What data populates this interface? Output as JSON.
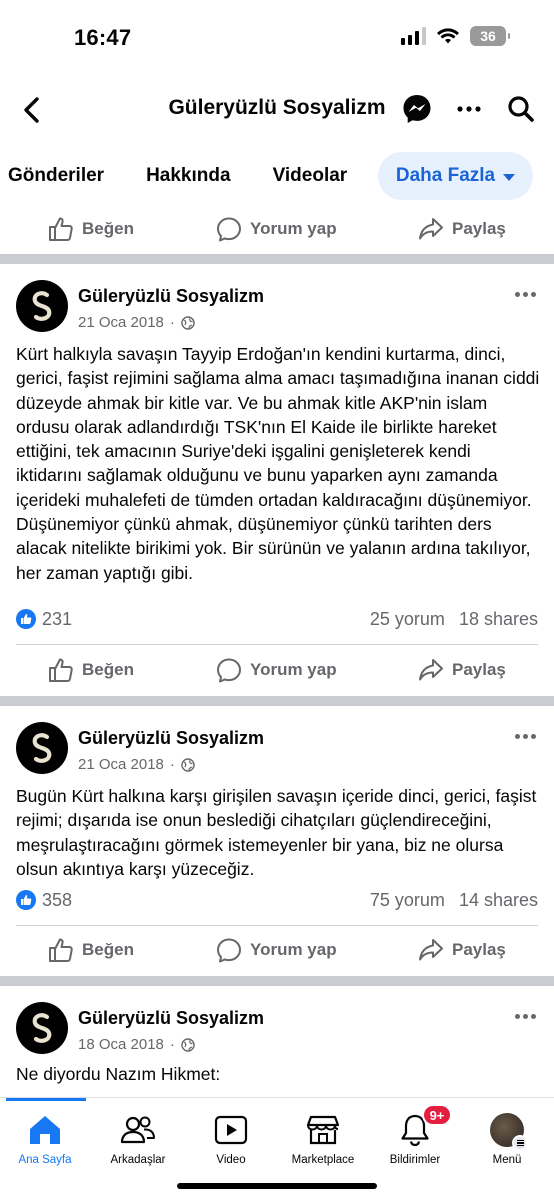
{
  "status_bar": {
    "time": "16:47",
    "battery": "36"
  },
  "header": {
    "title": "Güleryüzlü Sosyalizm"
  },
  "tabs": [
    {
      "label": "Gönderiler"
    },
    {
      "label": "Hakkında"
    },
    {
      "label": "Videolar"
    },
    {
      "label": "Daha Fazla",
      "active": true
    }
  ],
  "actions": {
    "like": "Beğen",
    "comment": "Yorum yap",
    "share": "Paylaş"
  },
  "posts": [
    {
      "author": "Güleryüzlü Sosyalizm",
      "date": "21 Oca 2018",
      "text": "Kürt halkıyla savaşın Tayyip Erdoğan'ın kendini kurtarma, dinci, gerici, faşist rejimini sağlama alma amacı taşımadığına inanan ciddi düzeyde ahmak bir kitle var. Ve bu ahmak kitle AKP'nin islam ordusu olarak adlandırdığı TSK'nın El Kaide ile birlikte hareket ettiğini, tek amacının Suriye'deki işgalini genişleterek kendi iktidarını sağlamak olduğunu ve bunu yaparken aynı zamanda içerideki muhalefeti de tümden ortadan kaldıracağını düşünemiyor. Düşünemiyor çünkü ahmak, düşünemiyor çünkü tarihten ders alacak nitelikte birikimi yok. Bir sürünün ve yalanın ardına takılıyor, her zaman yaptığı gibi.",
      "likes": "231",
      "comments": "25 yorum",
      "shares": "18 shares"
    },
    {
      "author": "Güleryüzlü Sosyalizm",
      "date": "21 Oca 2018",
      "text": "Bugün Kürt halkına karşı girişilen savaşın içeride dinci, gerici, faşist rejimi; dışarıda ise onun beslediği cihatçıları güçlendireceğini, meşrulaştıracağını görmek istemeyenler bir yana, biz ne olursa olsun akıntıya karşı yüzeceğiz.",
      "likes": "358",
      "comments": "75 yorum",
      "shares": "14 shares"
    },
    {
      "author": "Güleryüzlü Sosyalizm",
      "date": "18 Oca 2018",
      "text": "Ne diyordu Nazım Hikmet:"
    }
  ],
  "bottom_nav": {
    "items": [
      {
        "label": "Ana Sayfa",
        "icon": "home-icon",
        "active": true
      },
      {
        "label": "Arkadaşlar",
        "icon": "friends-icon"
      },
      {
        "label": "Video",
        "icon": "video-icon"
      },
      {
        "label": "Marketplace",
        "icon": "marketplace-icon"
      },
      {
        "label": "Bildirimler",
        "icon": "bell-icon",
        "badge": "9+"
      },
      {
        "label": "Menü",
        "icon": "profile-avatar"
      }
    ]
  },
  "colors": {
    "accent": "#1877f2",
    "tab_active_bg": "#e7f0fd",
    "badge": "#e41e3f"
  }
}
